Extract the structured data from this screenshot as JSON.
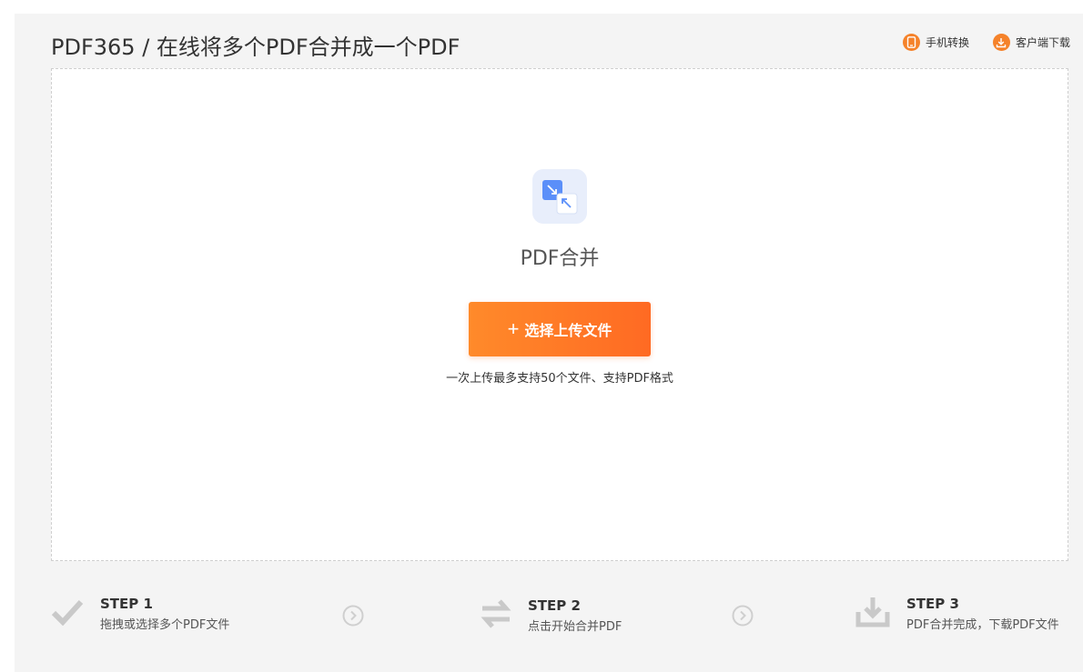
{
  "header": {
    "title": "PDF365 / 在线将多个PDF合并成一个PDF",
    "links": [
      {
        "label": "手机转换",
        "icon": "mobile-icon"
      },
      {
        "label": "客户端下载",
        "icon": "download-icon"
      }
    ]
  },
  "main": {
    "tool_name": "PDF合并",
    "upload_button": "选择上传文件",
    "upload_hint": "一次上传最多支持50个文件、支持PDF格式"
  },
  "steps": [
    {
      "title": "STEP 1",
      "desc": "拖拽或选择多个PDF文件",
      "icon": "checkmark-icon"
    },
    {
      "title": "STEP 2",
      "desc": "点击开始合并PDF",
      "icon": "swap-arrows-icon"
    },
    {
      "title": "STEP 3",
      "desc": "PDF合并完成，下载PDF文件",
      "icon": "download-tray-icon"
    }
  ],
  "colors": {
    "accent": "#ff7a26",
    "panel": "#f4f4f4",
    "icon_tile": "#e8eefb",
    "icon_blue": "#5b8ff9"
  }
}
